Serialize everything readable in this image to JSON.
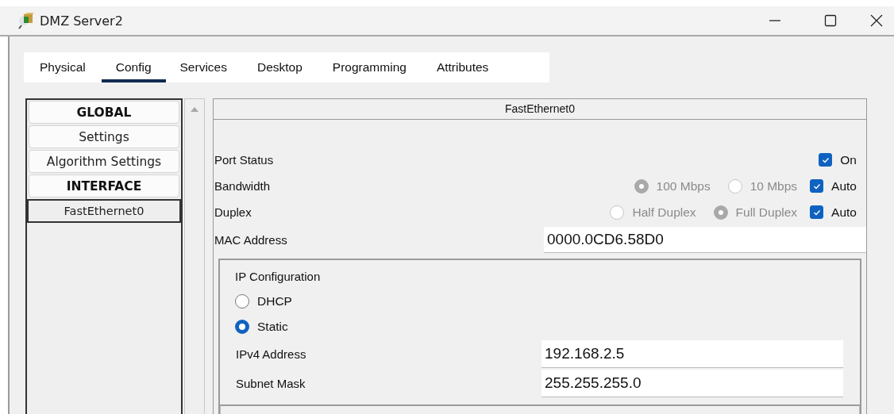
{
  "window": {
    "title": "DMZ Server2"
  },
  "tabs": [
    {
      "label": "Physical",
      "selected": false
    },
    {
      "label": "Config",
      "selected": true
    },
    {
      "label": "Services",
      "selected": false
    },
    {
      "label": "Desktop",
      "selected": false
    },
    {
      "label": "Programming",
      "selected": false
    },
    {
      "label": "Attributes",
      "selected": false
    }
  ],
  "sidebar": {
    "items": [
      {
        "kind": "header",
        "label": "GLOBAL",
        "selected": false
      },
      {
        "kind": "item",
        "label": "Settings",
        "selected": false
      },
      {
        "kind": "item",
        "label": "Algorithm Settings",
        "selected": false
      },
      {
        "kind": "header",
        "label": "INTERFACE",
        "selected": false
      },
      {
        "kind": "item",
        "label": "FastEthernet0",
        "selected": true
      }
    ]
  },
  "interface": {
    "title": "FastEthernet0",
    "settings": [
      {
        "kind": "toggle",
        "label": "Port Status",
        "checkbox": {
          "label": "On",
          "checked": true
        }
      },
      {
        "kind": "radios",
        "label": "Bandwidth",
        "disabled": true,
        "options": [
          {
            "label": "100 Mbps",
            "selected": true
          },
          {
            "label": "10 Mbps",
            "selected": false
          }
        ],
        "checkbox": {
          "label": "Auto",
          "checked": true
        }
      },
      {
        "kind": "radios",
        "label": "Duplex",
        "disabled": true,
        "options": [
          {
            "label": "Half Duplex",
            "selected": false
          },
          {
            "label": "Full Duplex",
            "selected": true
          }
        ],
        "checkbox": {
          "label": "Auto",
          "checked": true
        }
      },
      {
        "kind": "field",
        "label": "MAC Address",
        "value": "0000.0CD6.58D0"
      }
    ],
    "ip_configuration": {
      "title": "IP Configuration",
      "modes": [
        {
          "label": "DHCP",
          "selected": false
        },
        {
          "label": "Static",
          "selected": true
        }
      ],
      "fields": [
        {
          "label": "IPv4 Address",
          "value": "192.168.2.5"
        },
        {
          "label": "Subnet Mask",
          "value": "255.255.255.0"
        }
      ]
    }
  }
}
